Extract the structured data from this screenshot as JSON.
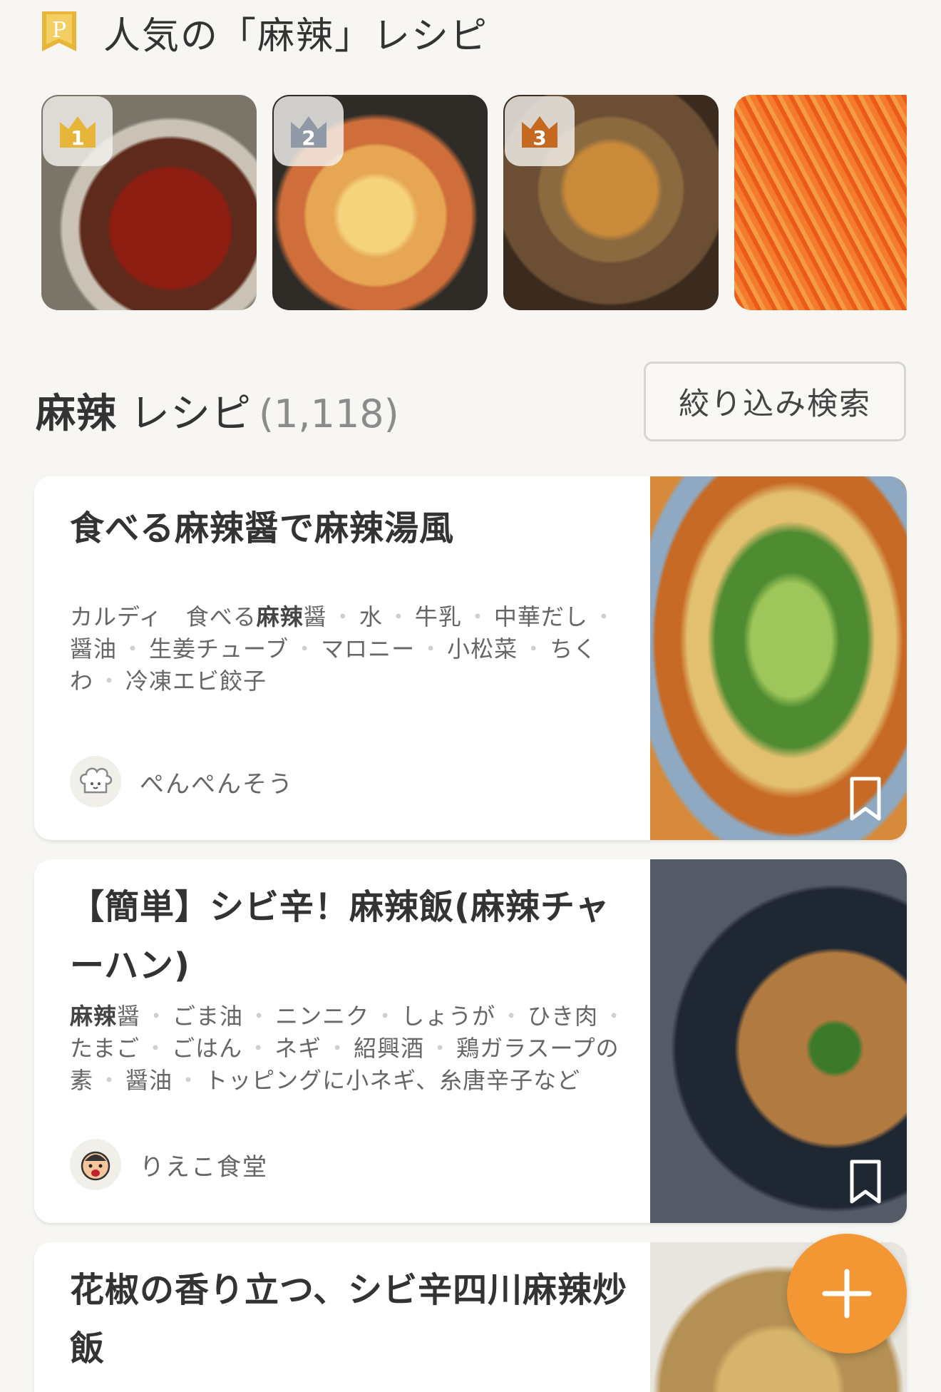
{
  "popular": {
    "badge_letter": "P",
    "title": "人気の「麻辣」レシピ",
    "ranks": [
      {
        "rank": "1",
        "crown_color": "#e7b53a"
      },
      {
        "rank": "2",
        "crown_color": "#8f9aa6"
      },
      {
        "rank": "3",
        "crown_color": "#c4691f"
      },
      {
        "rank": "",
        "crown_color": ""
      }
    ]
  },
  "results": {
    "term": "麻辣",
    "suffix": "レシピ",
    "count": "(1,118)",
    "filter_label": "絞り込み検索"
  },
  "recipes": [
    {
      "title": "食べる麻辣醤で麻辣湯風",
      "ingredients": [
        {
          "parts": [
            {
              "text": "カルディ　食べる",
              "bold": false
            },
            {
              "text": "麻辣",
              "bold": true
            },
            {
              "text": "醤",
              "bold": false
            }
          ]
        },
        {
          "parts": [
            {
              "text": "水",
              "bold": false
            }
          ]
        },
        {
          "parts": [
            {
              "text": "牛乳",
              "bold": false
            }
          ]
        },
        {
          "parts": [
            {
              "text": "中華だし",
              "bold": false
            }
          ]
        },
        {
          "parts": [
            {
              "text": "醤油",
              "bold": false
            }
          ]
        },
        {
          "parts": [
            {
              "text": "生姜チューブ",
              "bold": false
            }
          ]
        },
        {
          "parts": [
            {
              "text": "マロニー",
              "bold": false
            }
          ]
        },
        {
          "parts": [
            {
              "text": "小松菜",
              "bold": false
            }
          ]
        },
        {
          "parts": [
            {
              "text": "ちくわ",
              "bold": false
            }
          ]
        },
        {
          "parts": [
            {
              "text": "冷凍エビ餃子",
              "bold": false
            }
          ]
        }
      ],
      "author": "ぺんぺんそう",
      "avatar": "chef-hat-icon"
    },
    {
      "title": "【簡単】シビ辛！麻辣飯(麻辣チャーハン)",
      "ingredients": [
        {
          "parts": [
            {
              "text": "麻辣",
              "bold": true
            },
            {
              "text": "醤",
              "bold": false
            }
          ]
        },
        {
          "parts": [
            {
              "text": "ごま油",
              "bold": false
            }
          ]
        },
        {
          "parts": [
            {
              "text": "ニンニク",
              "bold": false
            }
          ]
        },
        {
          "parts": [
            {
              "text": "しょうが",
              "bold": false
            }
          ]
        },
        {
          "parts": [
            {
              "text": "ひき肉",
              "bold": false
            }
          ]
        },
        {
          "parts": [
            {
              "text": "たまご",
              "bold": false
            }
          ]
        },
        {
          "parts": [
            {
              "text": "ごはん",
              "bold": false
            }
          ]
        },
        {
          "parts": [
            {
              "text": "ネギ",
              "bold": false
            }
          ]
        },
        {
          "parts": [
            {
              "text": "紹興酒",
              "bold": false
            }
          ]
        },
        {
          "parts": [
            {
              "text": "鶏ガラスープの素",
              "bold": false
            }
          ]
        },
        {
          "parts": [
            {
              "text": "醤油",
              "bold": false
            }
          ]
        },
        {
          "parts": [
            {
              "text": "トッピングに小ネギ、糸唐辛子など",
              "bold": false
            }
          ]
        }
      ],
      "author": "りえこ食堂",
      "avatar": "face-icon"
    },
    {
      "title": "花椒の香り立つ、シビ辛四川麻辣炒飯",
      "ingredients": [],
      "author": "",
      "avatar": ""
    }
  ],
  "colors": {
    "accent": "#f39634",
    "badge": "#e7b53a",
    "background": "#f7f6f2"
  }
}
